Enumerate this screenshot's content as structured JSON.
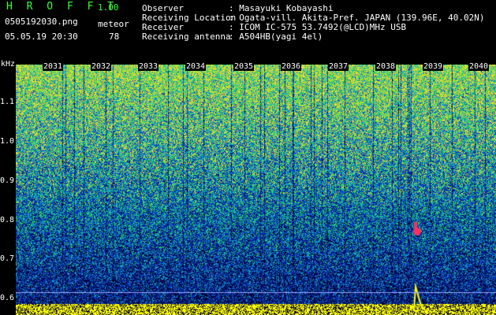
{
  "header": {
    "logo": "H R O F F T",
    "version": "1.00",
    "filename": "0505192030.png",
    "datetime": "05.05.19 20:30",
    "meteor_label": "meteor",
    "meteor_count": "78"
  },
  "meta": [
    {
      "label": "Observer",
      "value": ": Masayuki Kobayashi"
    },
    {
      "label": "Receiving Location",
      "value": ": Ogata-vill. Akita-Pref. JAPAN (139.96E, 40.02N)"
    },
    {
      "label": "Receiver",
      "value": ": ICOM IC-575 53.7492(@LCD)MHz USB"
    },
    {
      "label": "Receiving antenna",
      "value": ": A504HB(yagi 4el)"
    }
  ],
  "axis": {
    "unit": "kHz",
    "y_labels": [
      "1.1",
      "1.0",
      "0.9",
      "0.8",
      "0.7",
      "0.6"
    ],
    "x_labels": [
      "2031",
      "2032",
      "2033",
      "2034",
      "2035",
      "2036",
      "2037",
      "2038",
      "2039",
      "2040"
    ]
  },
  "colors": {
    "background": "#000000",
    "logo": "#3cff3c",
    "trace": "#ffff00",
    "meteor_echo": "#ff3060"
  }
}
